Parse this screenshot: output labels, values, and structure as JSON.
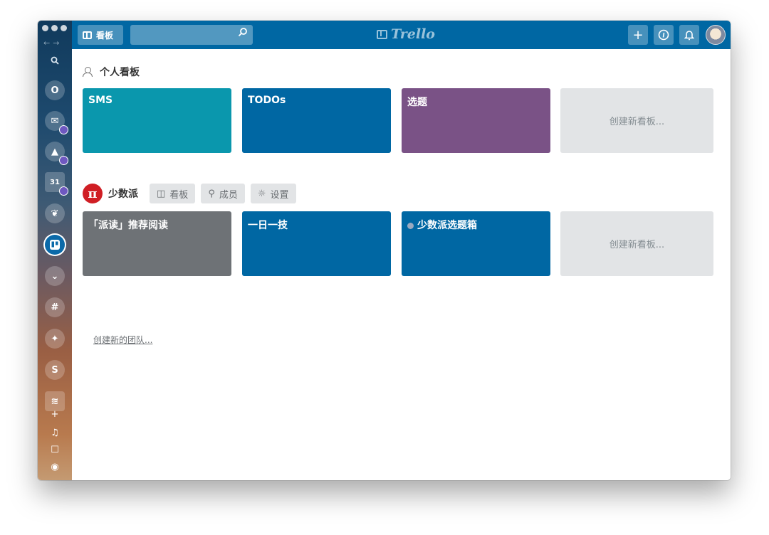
{
  "app": {
    "brand": "Trello"
  },
  "header": {
    "boards_label": "看板",
    "search_placeholder": ""
  },
  "personal": {
    "title": "个人看板",
    "boards": [
      {
        "name": "SMS",
        "color": "#0a97ad"
      },
      {
        "name": "TODOs",
        "color": "#0067a3"
      },
      {
        "name": "选题",
        "color": "#7a5286"
      }
    ],
    "create_label": "创建新看板..."
  },
  "team": {
    "name": "少数派",
    "logo_glyph": "π",
    "buttons": {
      "boards": "看板",
      "members": "成员",
      "settings": "设置"
    },
    "boards": [
      {
        "name": "「派读」推荐阅读",
        "color": "#6e7276"
      },
      {
        "name": "一日一技",
        "color": "#0067a3"
      },
      {
        "name": "少数派选题箱",
        "color": "#0067a3"
      }
    ],
    "create_label": "创建新看板..."
  },
  "create_team_label": "创建新的团队...",
  "dock": {
    "icons": [
      "search-icon",
      "outlook-icon",
      "mail-icon",
      "drive-icon",
      "calendar-icon",
      "evernote-icon",
      "trello-icon",
      "pocket-icon",
      "slack-icon",
      "twitter-icon",
      "skype-icon",
      "stack-icon"
    ],
    "calendar_day": "31"
  },
  "colors": {
    "topbar": "#0067a3",
    "create_card": "#e2e4e6"
  }
}
